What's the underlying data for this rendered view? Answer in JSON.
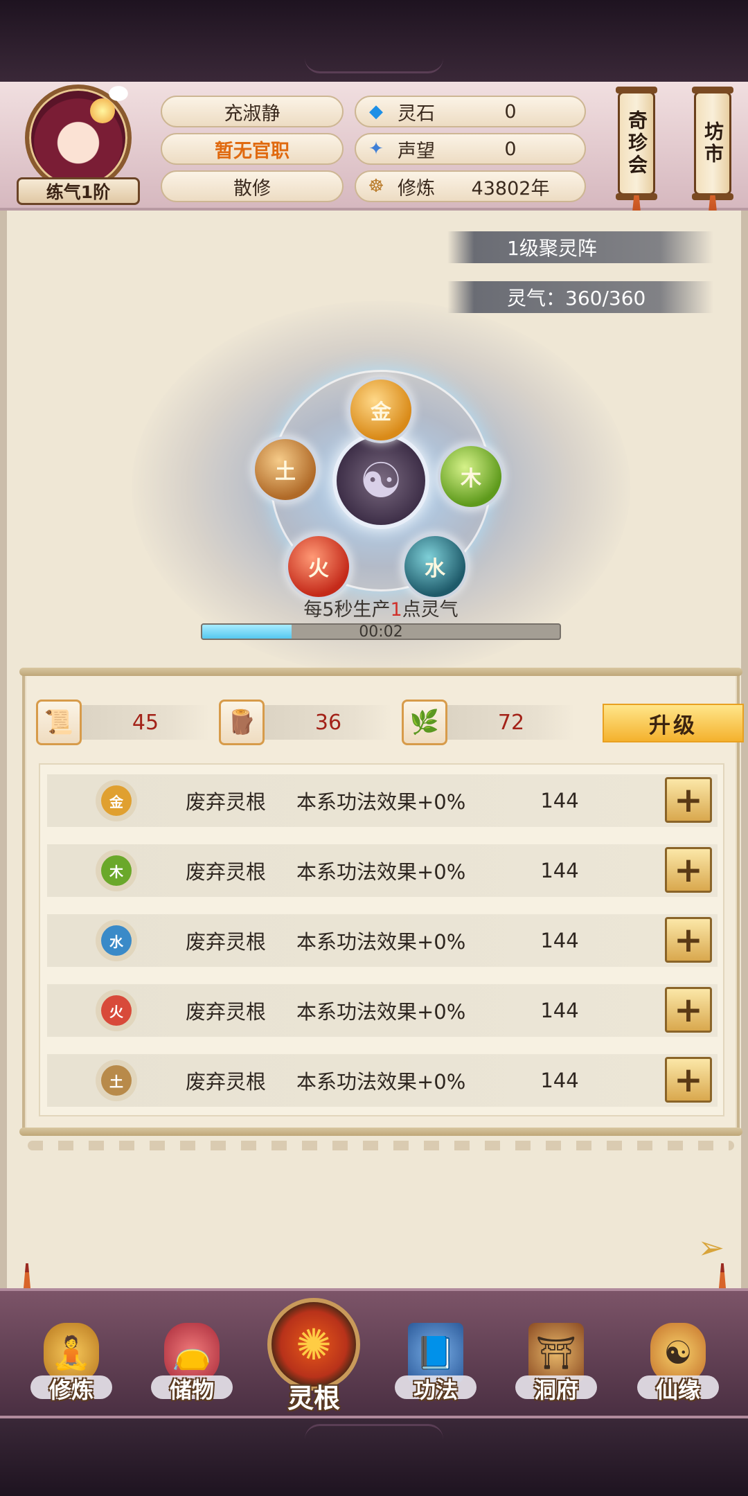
{
  "player": {
    "rank": "练气1阶",
    "name": "充淑静",
    "official_title": "暂无官职",
    "sect": "散修"
  },
  "resources": [
    {
      "icon": "spirit-stone-icon",
      "label": "灵石",
      "value": "0"
    },
    {
      "icon": "reputation-icon",
      "label": "声望",
      "value": "0"
    },
    {
      "icon": "cultivation-icon",
      "label": "修炼",
      "value": "43802年"
    }
  ],
  "side_buttons": {
    "treasure_fair": "奇珍会",
    "market": "坊市"
  },
  "array": {
    "level_label": "1级聚灵阵",
    "qi_label": "灵气：360/360",
    "elements": {
      "gold": "金",
      "wood": "木",
      "earth": "土",
      "fire": "火",
      "water": "水"
    },
    "production_prefix": "每5秒生产",
    "production_amount": "1",
    "production_suffix": "点灵气",
    "timer": "00:02",
    "progress_fraction": 0.25
  },
  "materials": [
    {
      "icon": "scroll-material-icon",
      "value": "45"
    },
    {
      "icon": "wood-material-icon",
      "value": "36"
    },
    {
      "icon": "herb-material-icon",
      "value": "72"
    }
  ],
  "upgrade_label": "升级",
  "spirit_roots": [
    {
      "element": "金",
      "color": "#e0a030",
      "root": "废弃灵根",
      "effect": "本系功法效果+0%",
      "cost": "144"
    },
    {
      "element": "木",
      "color": "#6aa82a",
      "root": "废弃灵根",
      "effect": "本系功法效果+0%",
      "cost": "144"
    },
    {
      "element": "水",
      "color": "#3a8ac8",
      "root": "废弃灵根",
      "effect": "本系功法效果+0%",
      "cost": "144"
    },
    {
      "element": "火",
      "color": "#d84a3a",
      "root": "废弃灵根",
      "effect": "本系功法效果+0%",
      "cost": "144"
    },
    {
      "element": "土",
      "color": "#b88a4a",
      "root": "废弃灵根",
      "effect": "本系功法效果+0%",
      "cost": "144"
    }
  ],
  "nav": [
    {
      "icon": "meditating-monk-icon",
      "label": "修炼"
    },
    {
      "icon": "storage-bag-icon",
      "label": "储物"
    },
    {
      "icon": "spirit-root-icon",
      "label": "灵根"
    },
    {
      "icon": "scripture-book-icon",
      "label": "功法"
    },
    {
      "icon": "cave-dwelling-icon",
      "label": "洞府"
    },
    {
      "icon": "gourd-destiny-icon",
      "label": "仙缘"
    }
  ]
}
